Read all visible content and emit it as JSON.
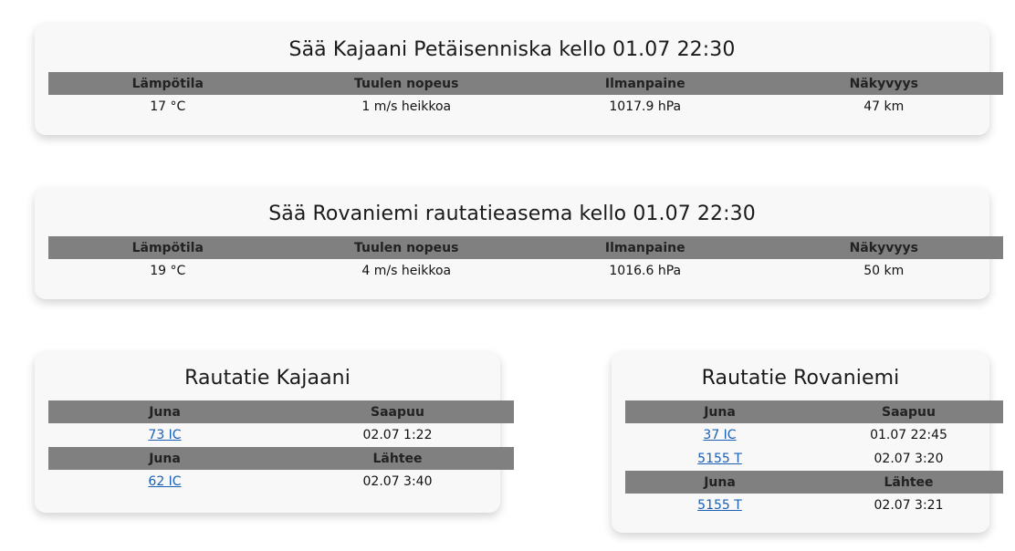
{
  "weather": [
    {
      "title": "Sää Kajaani Petäisenniska kello 01.07 22:30",
      "headers": [
        "Lämpötila",
        "Tuulen nopeus",
        "Ilmanpaine",
        "Näkyvyys"
      ],
      "values": [
        "17 °C",
        "1 m/s heikkoa",
        "1017.9 hPa",
        "47 km"
      ]
    },
    {
      "title": "Sää Rovaniemi rautatieasema kello 01.07 22:30",
      "headers": [
        "Lämpötila",
        "Tuulen nopeus",
        "Ilmanpaine",
        "Näkyvyys"
      ],
      "values": [
        "19 °C",
        "4 m/s heikkoa",
        "1016.6 hPa",
        "50 km"
      ]
    }
  ],
  "rail": [
    {
      "title": "Rautatie Kajaani",
      "arrivals": {
        "headers": [
          "Juna",
          "Saapuu"
        ],
        "rows": [
          {
            "train": "73 IC",
            "time": "02.07 1:22"
          }
        ]
      },
      "departures": {
        "headers": [
          "Juna",
          "Lähtee"
        ],
        "rows": [
          {
            "train": "62 IC",
            "time": "02.07 3:40"
          }
        ]
      }
    },
    {
      "title": "Rautatie Rovaniemi",
      "arrivals": {
        "headers": [
          "Juna",
          "Saapuu"
        ],
        "rows": [
          {
            "train": "37 IC",
            "time": "01.07 22:45"
          },
          {
            "train": "5155 T",
            "time": "02.07 3:20"
          }
        ]
      },
      "departures": {
        "headers": [
          "Juna",
          "Lähtee"
        ],
        "rows": [
          {
            "train": "5155 T",
            "time": "02.07 3:21"
          }
        ]
      }
    }
  ],
  "colors": {
    "header_bg": "#808080",
    "link": "#1a5fb4",
    "card_bg": "#f8f8f8"
  }
}
